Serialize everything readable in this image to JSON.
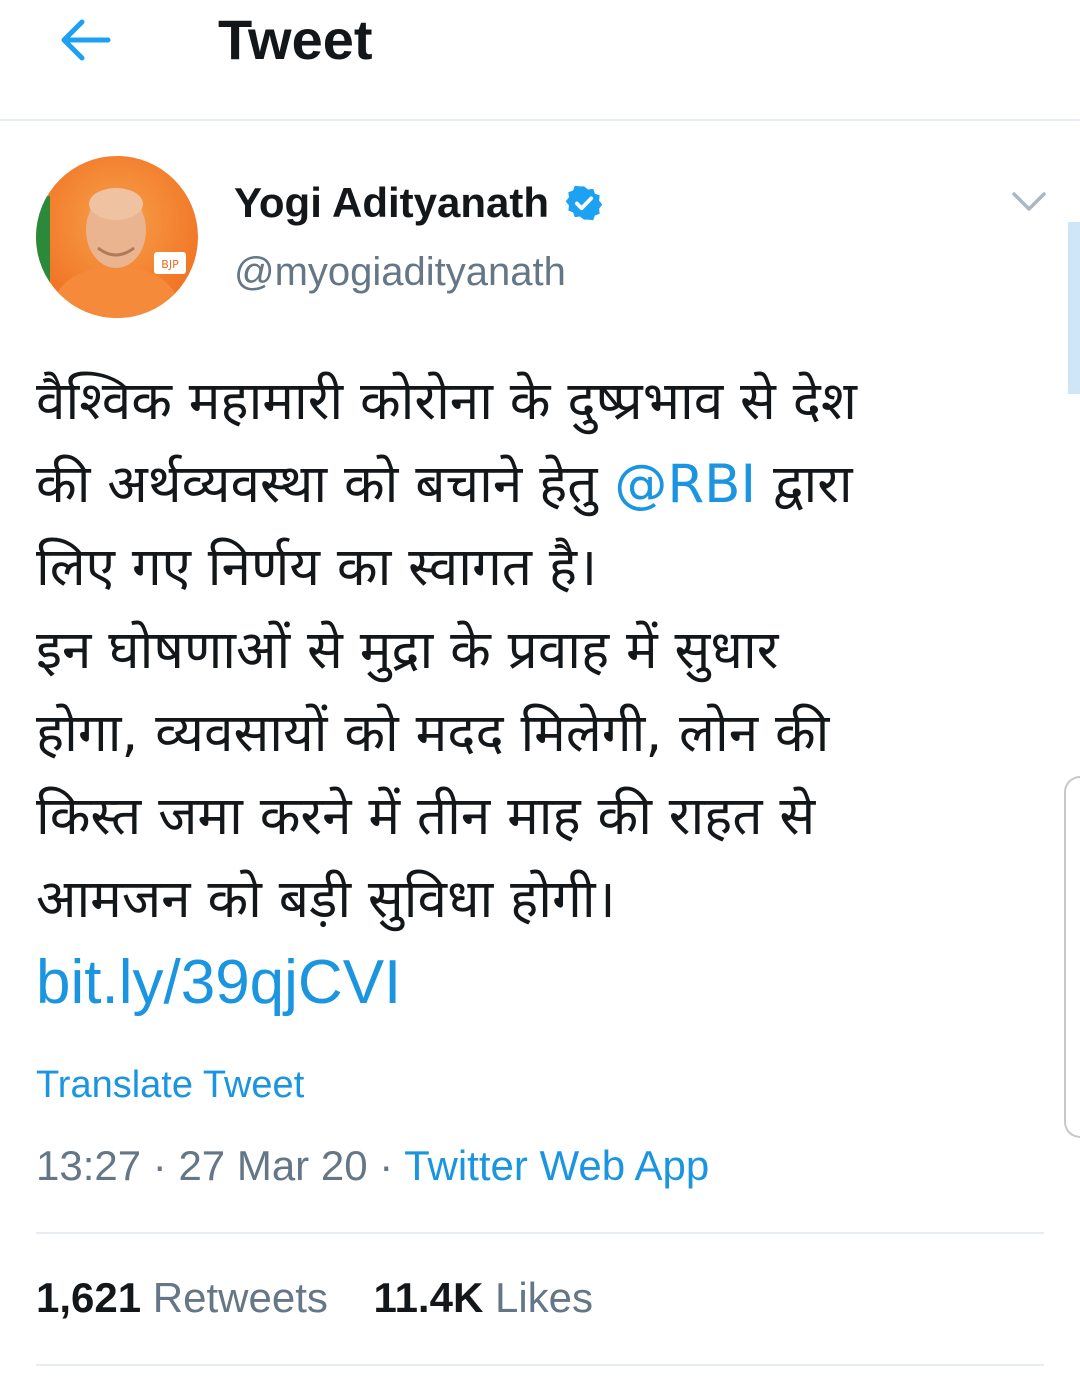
{
  "header": {
    "title": "Tweet",
    "back_icon": "arrow-left-icon",
    "accent": "#1da1f2"
  },
  "tweet": {
    "author": {
      "name": "Yogi Adityanath",
      "handle": "@myogiadityanath",
      "verified_icon": "verified-badge-icon",
      "avatar_label": "BJP"
    },
    "menu_icon": "chevron-down-icon",
    "body": {
      "line1": "वैश्विक महामारी कोरोना के दुष्प्रभाव से देश",
      "line2_pre": "की अर्थव्यवस्था को बचाने हेतु ",
      "mention": "@RBI",
      "line2_post": " द्वारा",
      "line3": "लिए गए निर्णय का स्वागत है।",
      "line4": "इन घोषणाओं से मुद्रा के प्रवाह में सुधार",
      "line5": "होगा, व्यवसायों को मदद मिलेगी, लोन की",
      "line6": "किस्त जमा करने में तीन माह की राहत से",
      "line7": "आमजन को बड़ी सुविधा होगी।",
      "link": "bit.ly/39qjCVI"
    },
    "translate_label": "Translate Tweet",
    "time": "13:27",
    "date": "27 Mar 20",
    "separator": "·",
    "source": "Twitter Web App",
    "stats": {
      "retweets_count": "1,621",
      "retweets_label": "Retweets",
      "likes_count": "11.4K",
      "likes_label": "Likes"
    }
  },
  "colors": {
    "link": "#1b95e0",
    "secondary_text": "#657786",
    "primary_text": "#14171a",
    "divider": "#e6ecf0"
  }
}
